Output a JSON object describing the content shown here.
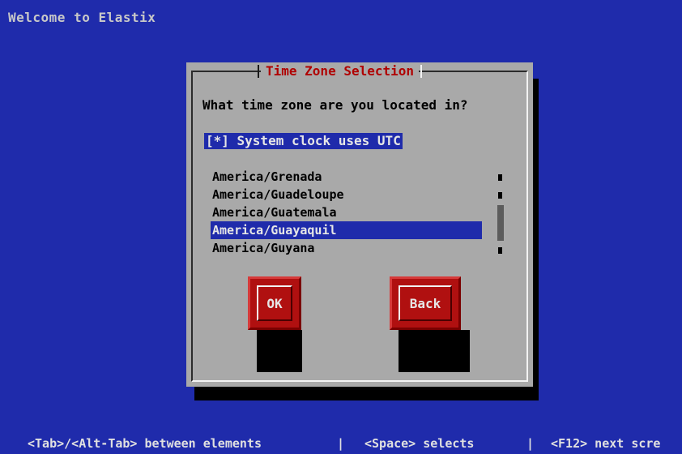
{
  "screen": {
    "welcome_text": "Welcome to Elastix"
  },
  "dialog": {
    "title": "Time Zone Selection",
    "question": "What time zone are you located in?",
    "utc_checkbox": {
      "label": "[*] System clock uses UTC",
      "checked": true
    },
    "timezones": [
      {
        "name": "America/Grenada",
        "selected": false
      },
      {
        "name": "America/Guadeloupe",
        "selected": false
      },
      {
        "name": "America/Guatemala",
        "selected": false
      },
      {
        "name": "America/Guayaquil",
        "selected": true
      },
      {
        "name": "America/Guyana",
        "selected": false
      }
    ],
    "buttons": {
      "ok_label": "OK",
      "back_label": "Back"
    }
  },
  "footer": {
    "hint_tab": "<Tab>/<Alt-Tab> between elements",
    "separator": "|",
    "hint_space": "<Space> selects",
    "hint_f12": "<F12> next scre"
  },
  "colors": {
    "background": "#1f2bab",
    "dialog": "#a9a9a9",
    "title": "#b00000",
    "button": "#b01010",
    "selection": "#1f2bab"
  }
}
